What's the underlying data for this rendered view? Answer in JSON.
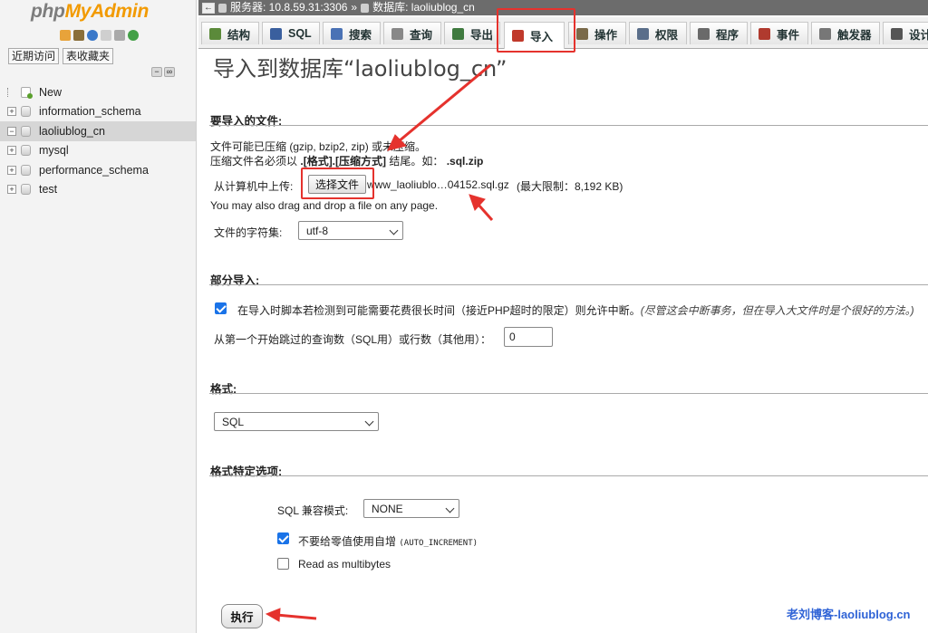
{
  "logo": {
    "php": "php",
    "myadmin": "MyAdmin"
  },
  "sidebar": {
    "tabs": [
      "近期访问",
      "表收藏夹"
    ],
    "tree": [
      {
        "label": "New",
        "type": "new"
      },
      {
        "label": "information_schema",
        "type": "db"
      },
      {
        "label": "laoliublog_cn",
        "type": "db",
        "active": true
      },
      {
        "label": "mysql",
        "type": "db"
      },
      {
        "label": "performance_schema",
        "type": "db"
      },
      {
        "label": "test",
        "type": "db"
      }
    ]
  },
  "breadcrumb": {
    "server": "服务器: 10.8.59.31:3306",
    "separator": "»",
    "database": "数据库: laoliublog_cn"
  },
  "tabs": [
    {
      "label": "结构",
      "color": "#5b8a3a"
    },
    {
      "label": "SQL",
      "color": "#3a5f9e"
    },
    {
      "label": "搜索",
      "color": "#4a72b5"
    },
    {
      "label": "查询",
      "color": "#888888"
    },
    {
      "label": "导出",
      "color": "#3f7a3f"
    },
    {
      "label": "导入",
      "color": "#c0392b",
      "active": true
    },
    {
      "label": "操作",
      "color": "#7a6a4a"
    },
    {
      "label": "权限",
      "color": "#5a6e8a"
    },
    {
      "label": "程序",
      "color": "#6a6a6a"
    },
    {
      "label": "事件",
      "color": "#b03a2e"
    },
    {
      "label": "触发器",
      "color": "#777777"
    },
    {
      "label": "设计",
      "color": "#555555"
    }
  ],
  "page_title": "导入到数据库“laoliublog_cn”",
  "file_section": {
    "heading": "要导入的文件:",
    "compress_line": "文件可能已压缩 (gzip, bzip2, zip) 或未压缩。",
    "name_prefix": "压缩文件名必须以",
    "name_bold": ".[格式].[压缩方式]",
    "name_mid": "结尾。如：",
    "name_example": ".sql.zip",
    "upload_label": "从计算机中上传:",
    "choose_button": "选择文件",
    "file_name": "www_laoliublo…04152.sql.gz",
    "max_limit": "(最大限制：8,192 KB)",
    "drag_hint": "You may also drag and drop a file on any page.",
    "charset_label": "文件的字符集:",
    "charset_value": "utf-8"
  },
  "partial_section": {
    "heading": "部分导入:",
    "allow_interrupt": "在导入时脚本若检测到可能需要花费很长时间（接近PHP超时的限定）则允许中断。",
    "allow_interrupt_note": "(尽管这会中断事务，但在导入大文件时是个很好的方法。)",
    "allow_interrupt_checked": true,
    "skip_label": "从第一个开始跳过的查询数（SQL用）或行数（其他用）：",
    "skip_value": "0"
  },
  "format_section": {
    "heading": "格式:",
    "value": "SQL"
  },
  "options_section": {
    "heading": "格式特定选项:",
    "compat_label": "SQL 兼容模式:",
    "compat_value": "NONE",
    "no_auto_zero_label": "不要给零值使用自增",
    "no_auto_zero_code": "(AUTO_INCREMENT)",
    "no_auto_zero_checked": true,
    "multibytes_label": "Read as multibytes",
    "multibytes_checked": false
  },
  "go_button": "执行",
  "watermark": "老刘博客-laoliublog.cn",
  "annotation_color": "#e5322d"
}
